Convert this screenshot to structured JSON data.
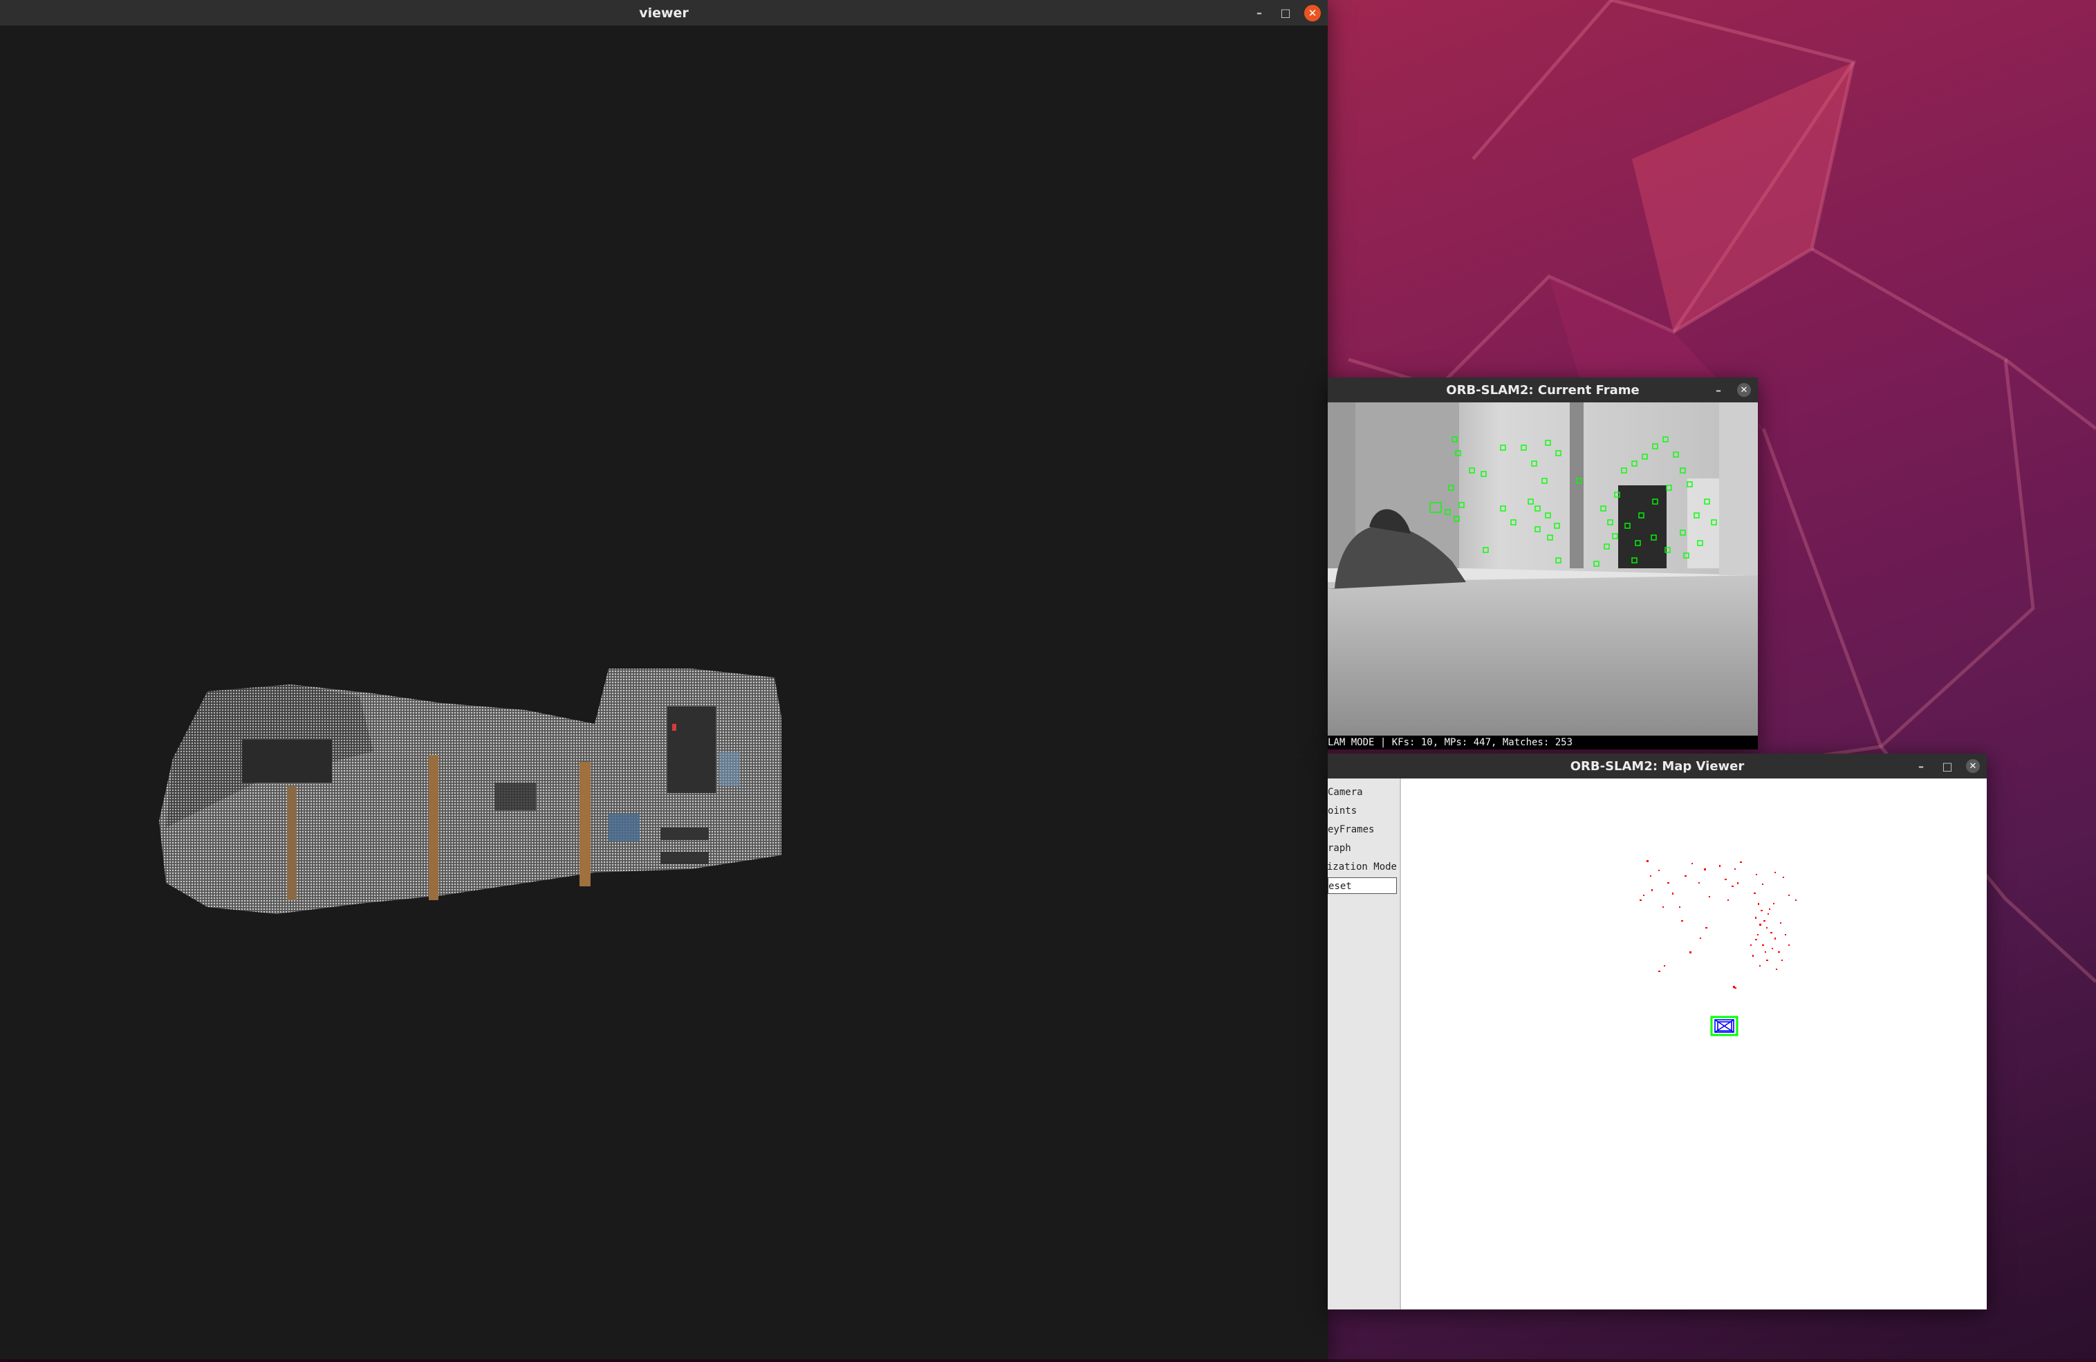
{
  "desktop": {
    "accent_color": "#e95420",
    "wallpaper_colors": [
      "#b8324a",
      "#7a1c55",
      "#2a0f2c"
    ]
  },
  "viewer_window": {
    "title": "viewer",
    "background": "#1a1a1a",
    "controls": [
      "minimize-icon",
      "maximize-icon",
      "close-icon"
    ]
  },
  "current_frame_window": {
    "title": "ORB-SLAM2: Current Frame",
    "status_text": "LAM MODE |  KFs: 10, MPs: 447, Matches: 253",
    "feature_color": "#00ff00"
  },
  "map_viewer_window": {
    "title": "ORB-SLAM2: Map Viewer",
    "panel_items": [
      {
        "label": "Camera"
      },
      {
        "label": "oints"
      },
      {
        "label": "eyFrames"
      },
      {
        "label": "raph"
      },
      {
        "label": "ization Mode"
      }
    ],
    "reset_label": "eset",
    "map_point_color": "#ff0000",
    "keyframe_color": "#0000ff",
    "current_camera_color": "#00ff00"
  }
}
